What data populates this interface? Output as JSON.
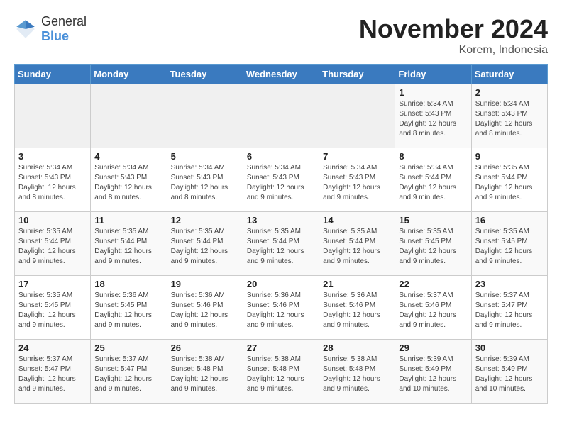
{
  "header": {
    "logo": {
      "general": "General",
      "blue": "Blue"
    },
    "title": "November 2024",
    "location": "Korem, Indonesia"
  },
  "calendar": {
    "days_of_week": [
      "Sunday",
      "Monday",
      "Tuesday",
      "Wednesday",
      "Thursday",
      "Friday",
      "Saturday"
    ],
    "weeks": [
      [
        {
          "day": "",
          "empty": true
        },
        {
          "day": "",
          "empty": true
        },
        {
          "day": "",
          "empty": true
        },
        {
          "day": "",
          "empty": true
        },
        {
          "day": "",
          "empty": true
        },
        {
          "day": "1",
          "sunrise": "Sunrise: 5:34 AM",
          "sunset": "Sunset: 5:43 PM",
          "daylight": "Daylight: 12 hours and 8 minutes."
        },
        {
          "day": "2",
          "sunrise": "Sunrise: 5:34 AM",
          "sunset": "Sunset: 5:43 PM",
          "daylight": "Daylight: 12 hours and 8 minutes."
        }
      ],
      [
        {
          "day": "3",
          "sunrise": "Sunrise: 5:34 AM",
          "sunset": "Sunset: 5:43 PM",
          "daylight": "Daylight: 12 hours and 8 minutes."
        },
        {
          "day": "4",
          "sunrise": "Sunrise: 5:34 AM",
          "sunset": "Sunset: 5:43 PM",
          "daylight": "Daylight: 12 hours and 8 minutes."
        },
        {
          "day": "5",
          "sunrise": "Sunrise: 5:34 AM",
          "sunset": "Sunset: 5:43 PM",
          "daylight": "Daylight: 12 hours and 8 minutes."
        },
        {
          "day": "6",
          "sunrise": "Sunrise: 5:34 AM",
          "sunset": "Sunset: 5:43 PM",
          "daylight": "Daylight: 12 hours and 9 minutes."
        },
        {
          "day": "7",
          "sunrise": "Sunrise: 5:34 AM",
          "sunset": "Sunset: 5:43 PM",
          "daylight": "Daylight: 12 hours and 9 minutes."
        },
        {
          "day": "8",
          "sunrise": "Sunrise: 5:34 AM",
          "sunset": "Sunset: 5:44 PM",
          "daylight": "Daylight: 12 hours and 9 minutes."
        },
        {
          "day": "9",
          "sunrise": "Sunrise: 5:35 AM",
          "sunset": "Sunset: 5:44 PM",
          "daylight": "Daylight: 12 hours and 9 minutes."
        }
      ],
      [
        {
          "day": "10",
          "sunrise": "Sunrise: 5:35 AM",
          "sunset": "Sunset: 5:44 PM",
          "daylight": "Daylight: 12 hours and 9 minutes."
        },
        {
          "day": "11",
          "sunrise": "Sunrise: 5:35 AM",
          "sunset": "Sunset: 5:44 PM",
          "daylight": "Daylight: 12 hours and 9 minutes."
        },
        {
          "day": "12",
          "sunrise": "Sunrise: 5:35 AM",
          "sunset": "Sunset: 5:44 PM",
          "daylight": "Daylight: 12 hours and 9 minutes."
        },
        {
          "day": "13",
          "sunrise": "Sunrise: 5:35 AM",
          "sunset": "Sunset: 5:44 PM",
          "daylight": "Daylight: 12 hours and 9 minutes."
        },
        {
          "day": "14",
          "sunrise": "Sunrise: 5:35 AM",
          "sunset": "Sunset: 5:44 PM",
          "daylight": "Daylight: 12 hours and 9 minutes."
        },
        {
          "day": "15",
          "sunrise": "Sunrise: 5:35 AM",
          "sunset": "Sunset: 5:45 PM",
          "daylight": "Daylight: 12 hours and 9 minutes."
        },
        {
          "day": "16",
          "sunrise": "Sunrise: 5:35 AM",
          "sunset": "Sunset: 5:45 PM",
          "daylight": "Daylight: 12 hours and 9 minutes."
        }
      ],
      [
        {
          "day": "17",
          "sunrise": "Sunrise: 5:35 AM",
          "sunset": "Sunset: 5:45 PM",
          "daylight": "Daylight: 12 hours and 9 minutes."
        },
        {
          "day": "18",
          "sunrise": "Sunrise: 5:36 AM",
          "sunset": "Sunset: 5:45 PM",
          "daylight": "Daylight: 12 hours and 9 minutes."
        },
        {
          "day": "19",
          "sunrise": "Sunrise: 5:36 AM",
          "sunset": "Sunset: 5:46 PM",
          "daylight": "Daylight: 12 hours and 9 minutes."
        },
        {
          "day": "20",
          "sunrise": "Sunrise: 5:36 AM",
          "sunset": "Sunset: 5:46 PM",
          "daylight": "Daylight: 12 hours and 9 minutes."
        },
        {
          "day": "21",
          "sunrise": "Sunrise: 5:36 AM",
          "sunset": "Sunset: 5:46 PM",
          "daylight": "Daylight: 12 hours and 9 minutes."
        },
        {
          "day": "22",
          "sunrise": "Sunrise: 5:37 AM",
          "sunset": "Sunset: 5:46 PM",
          "daylight": "Daylight: 12 hours and 9 minutes."
        },
        {
          "day": "23",
          "sunrise": "Sunrise: 5:37 AM",
          "sunset": "Sunset: 5:47 PM",
          "daylight": "Daylight: 12 hours and 9 minutes."
        }
      ],
      [
        {
          "day": "24",
          "sunrise": "Sunrise: 5:37 AM",
          "sunset": "Sunset: 5:47 PM",
          "daylight": "Daylight: 12 hours and 9 minutes."
        },
        {
          "day": "25",
          "sunrise": "Sunrise: 5:37 AM",
          "sunset": "Sunset: 5:47 PM",
          "daylight": "Daylight: 12 hours and 9 minutes."
        },
        {
          "day": "26",
          "sunrise": "Sunrise: 5:38 AM",
          "sunset": "Sunset: 5:48 PM",
          "daylight": "Daylight: 12 hours and 9 minutes."
        },
        {
          "day": "27",
          "sunrise": "Sunrise: 5:38 AM",
          "sunset": "Sunset: 5:48 PM",
          "daylight": "Daylight: 12 hours and 9 minutes."
        },
        {
          "day": "28",
          "sunrise": "Sunrise: 5:38 AM",
          "sunset": "Sunset: 5:48 PM",
          "daylight": "Daylight: 12 hours and 9 minutes."
        },
        {
          "day": "29",
          "sunrise": "Sunrise: 5:39 AM",
          "sunset": "Sunset: 5:49 PM",
          "daylight": "Daylight: 12 hours and 10 minutes."
        },
        {
          "day": "30",
          "sunrise": "Sunrise: 5:39 AM",
          "sunset": "Sunset: 5:49 PM",
          "daylight": "Daylight: 12 hours and 10 minutes."
        }
      ]
    ]
  }
}
